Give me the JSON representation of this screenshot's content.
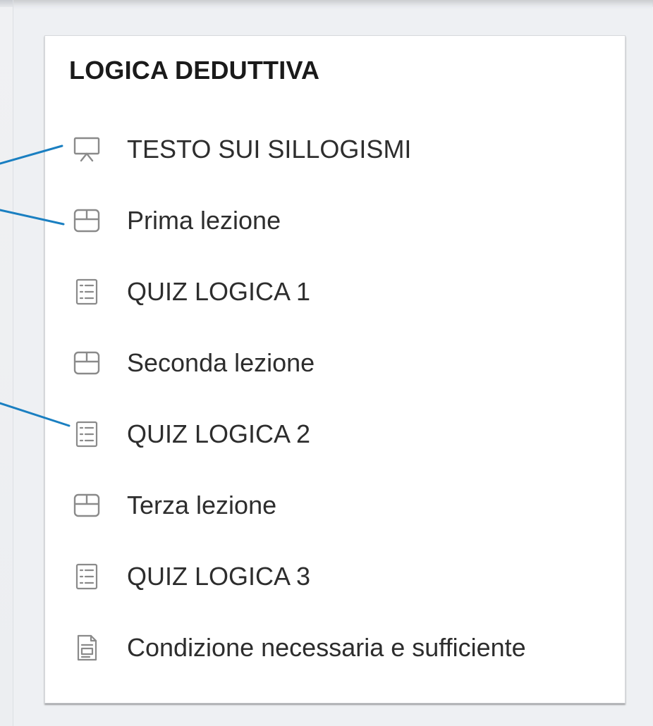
{
  "section": {
    "title": "LOGICA DEDUTTIVA",
    "items": [
      {
        "label": "TESTO SUI SILLOGISMI",
        "icon": "presentation-icon"
      },
      {
        "label": "Prima lezione",
        "icon": "lesson-icon"
      },
      {
        "label": "QUIZ LOGICA 1",
        "icon": "quiz-icon"
      },
      {
        "label": "Seconda lezione",
        "icon": "lesson-icon"
      },
      {
        "label": "QUIZ LOGICA 2",
        "icon": "quiz-icon"
      },
      {
        "label": "Terza lezione",
        "icon": "lesson-icon"
      },
      {
        "label": "QUIZ LOGICA 3",
        "icon": "quiz-icon"
      },
      {
        "label": "Condizione necessaria e sufficiente",
        "icon": "page-icon"
      }
    ]
  },
  "colors": {
    "callout_line": "#1a7fc1",
    "icon": "#8a8a8a",
    "text": "#2d2d2d"
  }
}
